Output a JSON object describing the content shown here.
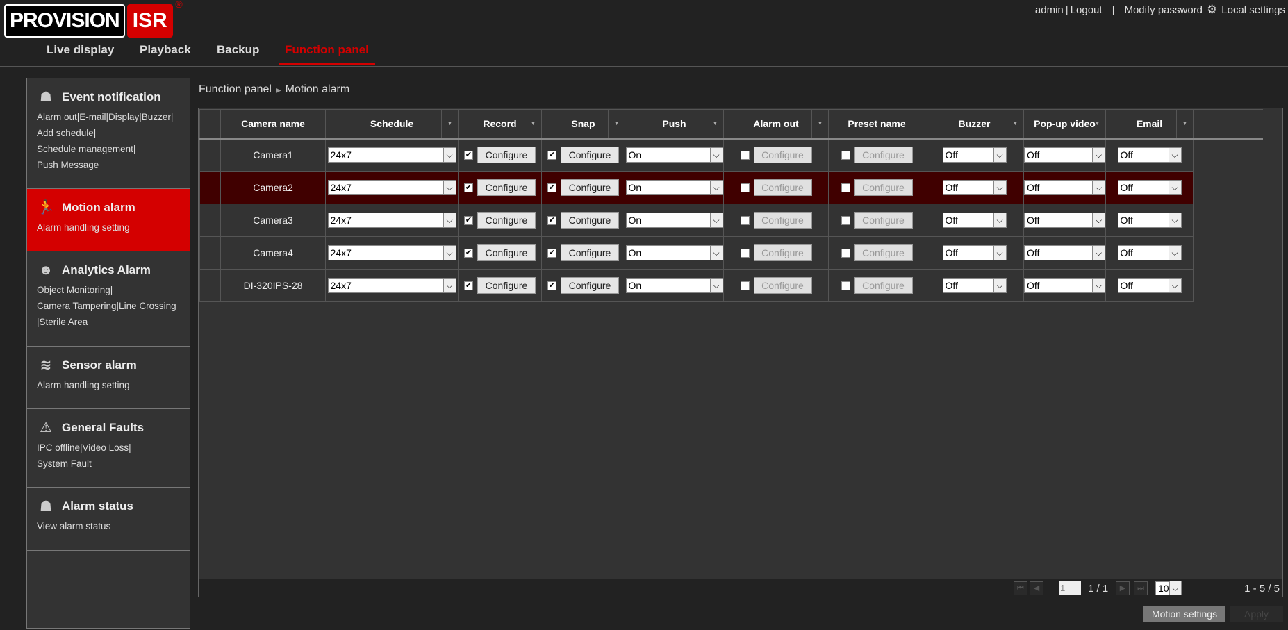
{
  "logo": {
    "left": "PROVISION",
    "right": "ISR",
    "mark": "®"
  },
  "topbar": {
    "user": "admin",
    "sep1": "|",
    "logout": "Logout",
    "sep2": "|",
    "modify_password": "Modify password",
    "local_settings": "Local settings",
    "gear_icon": "gear-icon"
  },
  "nav": {
    "tabs": [
      "Live display",
      "Playback",
      "Backup",
      "Function panel"
    ],
    "active": "Function panel"
  },
  "sidebar": [
    {
      "title": "Event notification",
      "icon": "event-notification-icon",
      "links": [
        "Alarm out|E-mail|Display|Buzzer|",
        "Add schedule|",
        "Schedule management|",
        "Push Message"
      ]
    },
    {
      "title": "Motion alarm",
      "icon": "motion-runner-icon",
      "links": [
        "Alarm handling setting"
      ],
      "active": true
    },
    {
      "title": "Analytics Alarm",
      "icon": "analytics-icon",
      "links": [
        "Object Monitoring|",
        "Camera Tampering|Line Crossing",
        "|Sterile Area"
      ]
    },
    {
      "title": "Sensor alarm",
      "icon": "sensor-icon",
      "links": [
        "Alarm handling setting"
      ]
    },
    {
      "title": "General Faults",
      "icon": "fault-icon",
      "links": [
        "IPC offline|Video Loss|",
        "System Fault"
      ]
    },
    {
      "title": "Alarm status",
      "icon": "alarm-status-icon",
      "links": [
        "View alarm status"
      ]
    }
  ],
  "breadcrumb": [
    "Function panel",
    "Motion alarm"
  ],
  "table": {
    "headers": [
      "Camera name",
      "Schedule",
      "Record",
      "Snap",
      "Push",
      "Alarm out",
      "Preset name",
      "Buzzer",
      "Pop-up video",
      "Email"
    ],
    "configure_label": "Configure",
    "selected_row": 1,
    "rows": [
      {
        "camera": "Camera1",
        "schedule": "24x7",
        "record": true,
        "snap": true,
        "push": "On",
        "alarm_out": false,
        "preset": false,
        "buzzer": "Off",
        "popup": "Off",
        "email": "Off"
      },
      {
        "camera": "Camera2",
        "schedule": "24x7",
        "record": true,
        "snap": true,
        "push": "On",
        "alarm_out": false,
        "preset": false,
        "buzzer": "Off",
        "popup": "Off",
        "email": "Off"
      },
      {
        "camera": "Camera3",
        "schedule": "24x7",
        "record": true,
        "snap": true,
        "push": "On",
        "alarm_out": false,
        "preset": false,
        "buzzer": "Off",
        "popup": "Off",
        "email": "Off"
      },
      {
        "camera": "Camera4",
        "schedule": "24x7",
        "record": true,
        "snap": true,
        "push": "On",
        "alarm_out": false,
        "preset": false,
        "buzzer": "Off",
        "popup": "Off",
        "email": "Off"
      },
      {
        "camera": "DI-320IPS-28",
        "schedule": "24x7",
        "record": true,
        "snap": true,
        "push": "On",
        "alarm_out": false,
        "preset": false,
        "buzzer": "Off",
        "popup": "Off",
        "email": "Off"
      }
    ]
  },
  "pager": {
    "page_input": "1",
    "page_total": "1 / 1",
    "per_page": "10",
    "range": "1 - 5 / 5"
  },
  "buttons": {
    "motion_settings": "Motion settings",
    "apply": "Apply"
  },
  "colors": {
    "accent": "#d40000",
    "selected_row": "#400000"
  }
}
